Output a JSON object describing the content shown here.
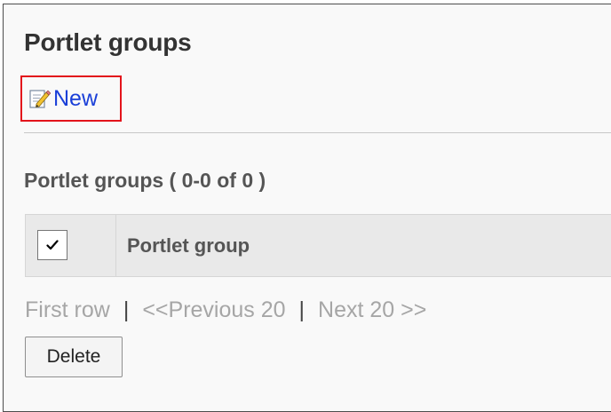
{
  "header": {
    "title": "Portlet groups"
  },
  "toolbar": {
    "new_label": "New",
    "new_icon": "edit-note-icon"
  },
  "list": {
    "title": "Portlet groups ( 0-0 of 0 )",
    "columns": [
      "Portlet group"
    ],
    "rows": []
  },
  "pagination": {
    "first": "First row",
    "separator": "|",
    "previous": "<<Previous 20",
    "next": "Next 20 >>"
  },
  "actions": {
    "delete_label": "Delete"
  },
  "colors": {
    "highlight": "#e3141b",
    "link": "#1a3fd8",
    "disabled_text": "#a6a6a6"
  }
}
